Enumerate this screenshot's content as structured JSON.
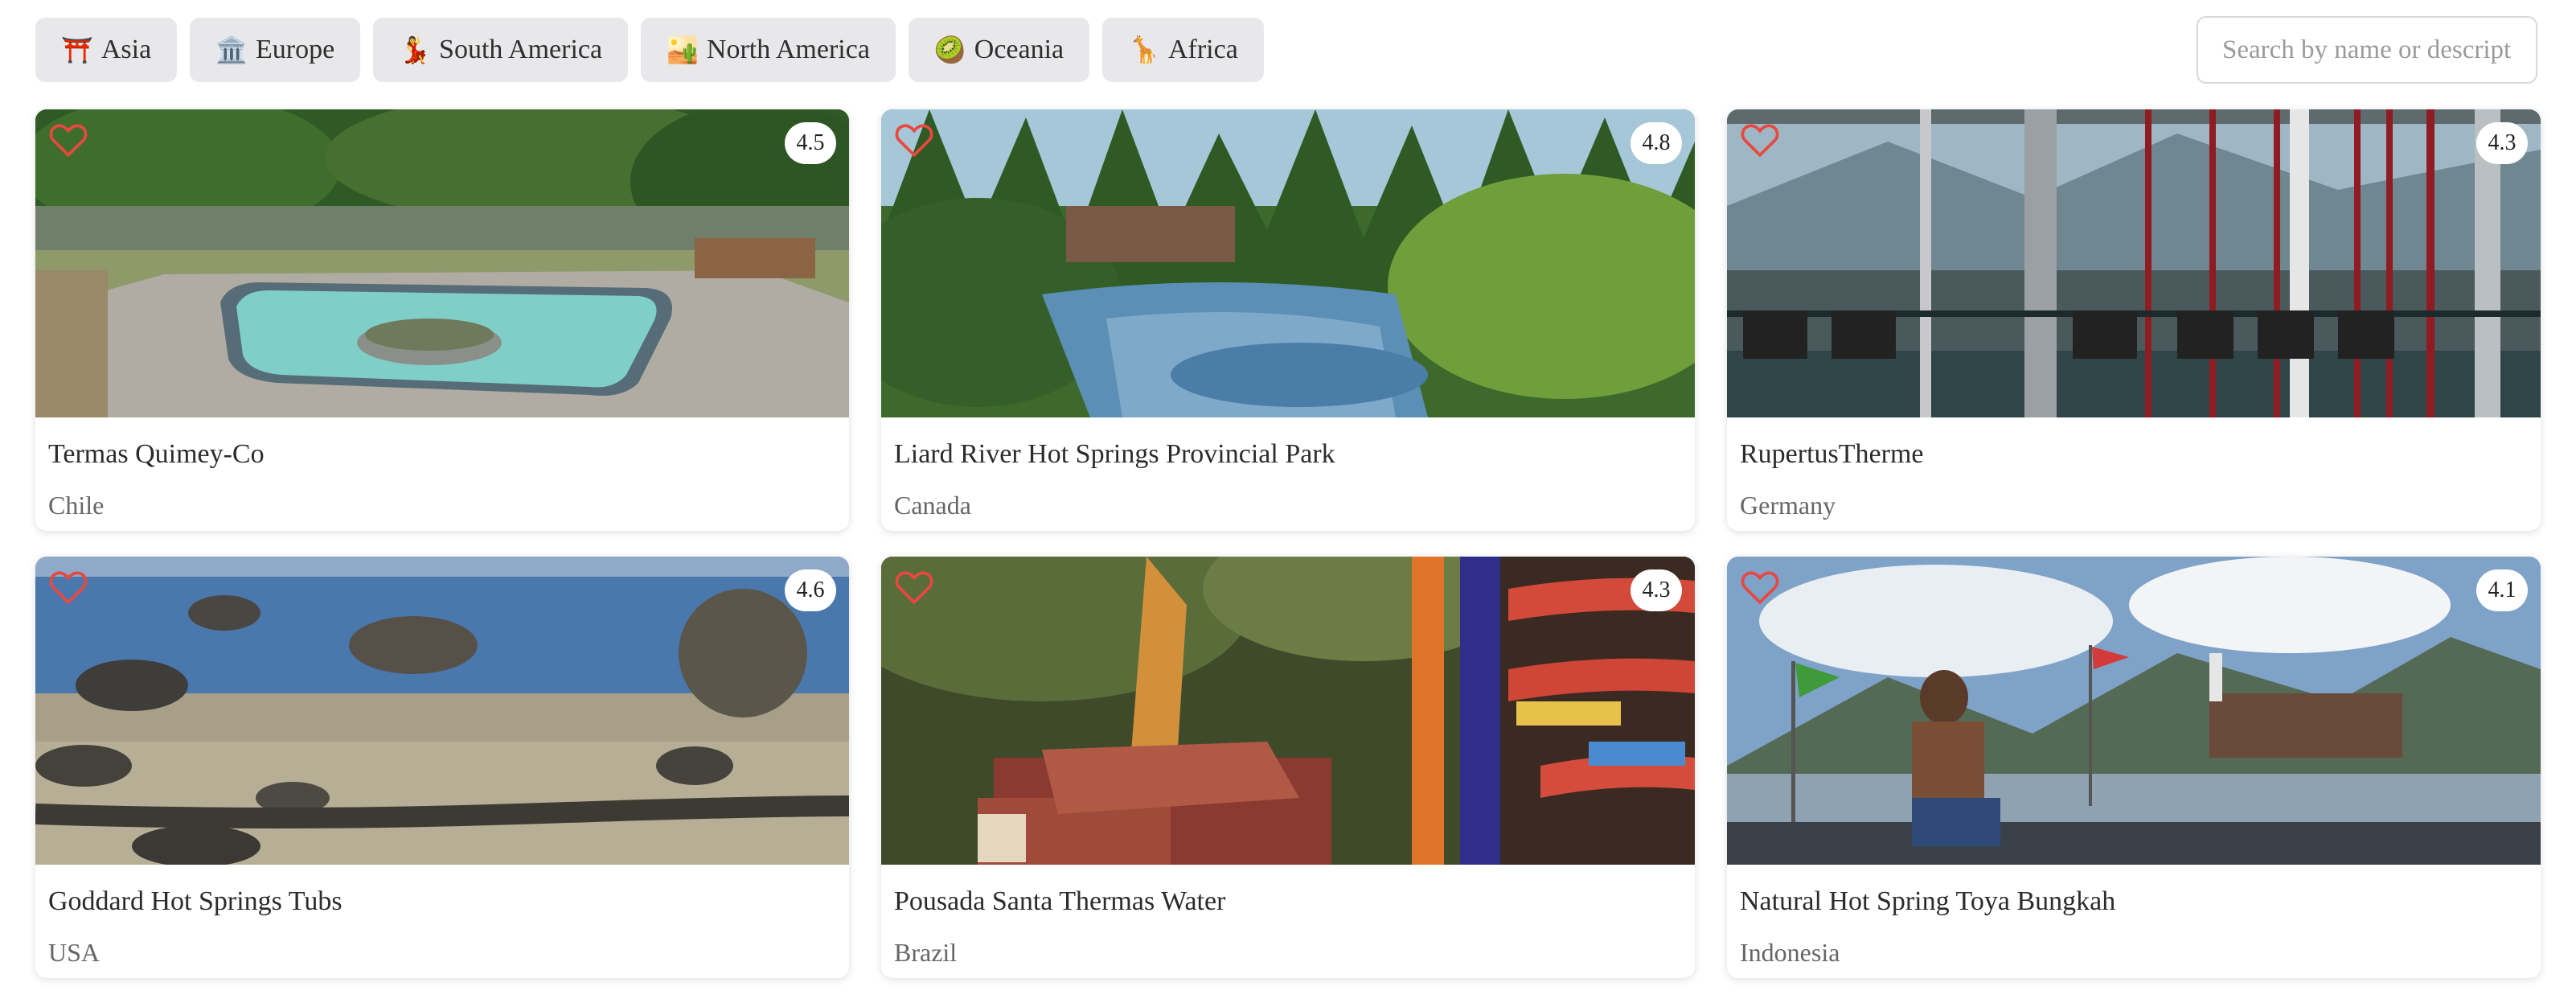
{
  "filters": [
    {
      "id": "asia",
      "emoji": "⛩️",
      "label": "Asia"
    },
    {
      "id": "europe",
      "emoji": "🏛️",
      "label": "Europe"
    },
    {
      "id": "south-america",
      "emoji": "💃",
      "label": "South America"
    },
    {
      "id": "north-america",
      "emoji": "🏜️",
      "label": "North America"
    },
    {
      "id": "oceania",
      "emoji": "🥝",
      "label": "Oceania"
    },
    {
      "id": "africa",
      "emoji": "🦒",
      "label": "Africa"
    }
  ],
  "search": {
    "placeholder": "Search by name or description",
    "value": ""
  },
  "colors": {
    "heart": "#e8483f",
    "chip_bg": "#e8e8ea"
  },
  "cards": [
    {
      "name": "Termas Quimey-Co",
      "country": "Chile",
      "rating": "4.5",
      "favorited": false
    },
    {
      "name": "Liard River Hot Springs Provincial Park",
      "country": "Canada",
      "rating": "4.8",
      "favorited": false
    },
    {
      "name": "RupertusTherme",
      "country": "Germany",
      "rating": "4.3",
      "favorited": false
    },
    {
      "name": "Goddard Hot Springs Tubs",
      "country": "USA",
      "rating": "4.6",
      "favorited": false
    },
    {
      "name": "Pousada Santa Thermas Water",
      "country": "Brazil",
      "rating": "4.3",
      "favorited": false
    },
    {
      "name": "Natural Hot Spring Toya Bungkah",
      "country": "Indonesia",
      "rating": "4.1",
      "favorited": false
    }
  ]
}
